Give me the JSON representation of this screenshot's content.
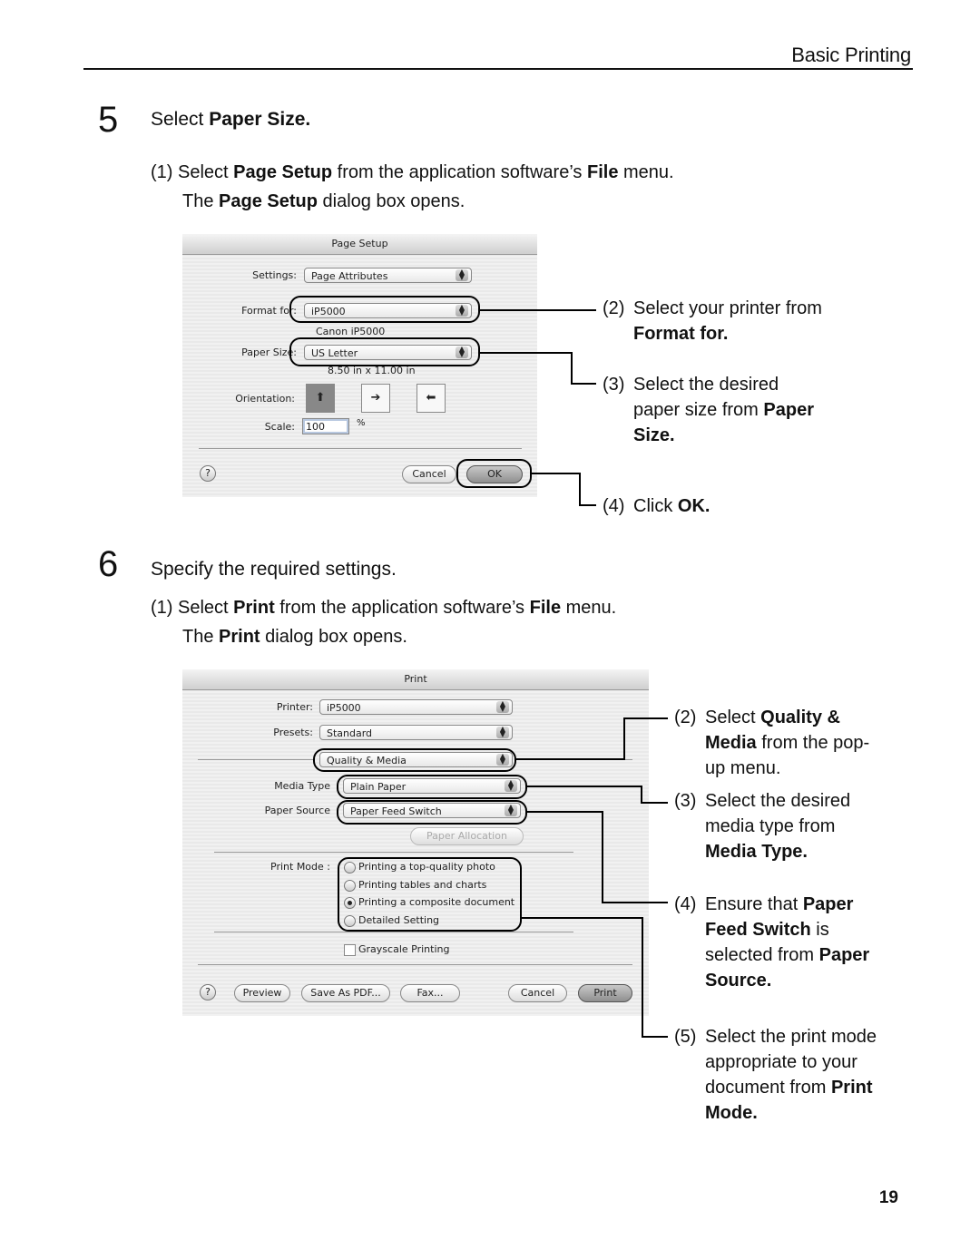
{
  "header": {
    "section": "Basic Printing"
  },
  "step5": {
    "number": "5",
    "title_prefix": "Select ",
    "title_bold": "Paper Size.",
    "instruction": {
      "n": "(1)",
      "l1_a": "Select ",
      "l1_b": "Page Setup",
      "l1_c": " from the application software’s ",
      "l1_d": "File",
      "l1_e": " menu.",
      "l2_a": "The ",
      "l2_b": "Page Setup",
      "l2_c": " dialog box opens."
    },
    "dialog": {
      "title": "Page Setup",
      "settings_label": "Settings:",
      "settings_value": "Page Attributes",
      "format_label": "Format for:",
      "format_value": "iP5000",
      "format_sub": "Canon iP5000",
      "papersize_label": "Paper Size:",
      "papersize_value": "US Letter",
      "papersize_sub": "8.50 in x 11.00 in",
      "orientation_label": "Orientation:",
      "scale_label": "Scale:",
      "scale_value": "100",
      "scale_unit": "%",
      "help": "?",
      "cancel": "Cancel",
      "ok": "OK"
    },
    "callouts": [
      {
        "n": "(2)",
        "a": "Select your printer from",
        "b": "Format for."
      },
      {
        "n": "(3)",
        "a": "Select the desired",
        "b": "paper size from ",
        "c": "Paper",
        "d": "Size."
      },
      {
        "n": "(4)",
        "a": "Click ",
        "b": "OK."
      }
    ]
  },
  "step6": {
    "number": "6",
    "title": "Specify the required settings.",
    "instruction": {
      "n": "(1)",
      "l1_a": "Select ",
      "l1_b": "Print",
      "l1_c": " from the application software’s ",
      "l1_d": "File",
      "l1_e": " menu.",
      "l2_a": "The ",
      "l2_b": "Print",
      "l2_c": " dialog box opens."
    },
    "dialog": {
      "title": "Print",
      "printer_label": "Printer:",
      "printer_value": "iP5000",
      "presets_label": "Presets:",
      "presets_value": "Standard",
      "panel_value": "Quality & Media",
      "mediatype_label": "Media Type",
      "mediatype_value": "Plain Paper",
      "papersource_label": "Paper Source",
      "papersource_value": "Paper Feed Switch",
      "paper_allocation": "Paper Allocation",
      "printmode_label": "Print Mode :",
      "printmode_options": [
        {
          "label": "Printing a top-quality photo",
          "selected": false
        },
        {
          "label": "Printing tables and charts",
          "selected": false
        },
        {
          "label": "Printing a composite document",
          "selected": true
        },
        {
          "label": "Detailed Setting",
          "selected": false
        }
      ],
      "grayscale_label": "Grayscale Printing",
      "grayscale_checked": false,
      "help": "?",
      "preview": "Preview",
      "save_pdf": "Save As PDF...",
      "fax": "Fax...",
      "cancel": "Cancel",
      "print": "Print"
    },
    "callouts": [
      {
        "n": "(2)",
        "a": "Select ",
        "b": "Quality &",
        "c": "Media",
        "d": " from the pop-",
        "e": "up menu."
      },
      {
        "n": "(3)",
        "a": "Select the desired",
        "b": "media type from",
        "c": "Media Type."
      },
      {
        "n": "(4)",
        "a": "Ensure that ",
        "b": "Paper",
        "c": "Feed Switch",
        "d": " is",
        "e": "selected from ",
        "f": "Paper",
        "g": "Source."
      },
      {
        "n": "(5)",
        "a": "Select the print mode",
        "b": "appropriate to your",
        "c": "document from ",
        "d": "Print",
        "e": "Mode."
      }
    ]
  },
  "footer": {
    "page_number": "19"
  }
}
